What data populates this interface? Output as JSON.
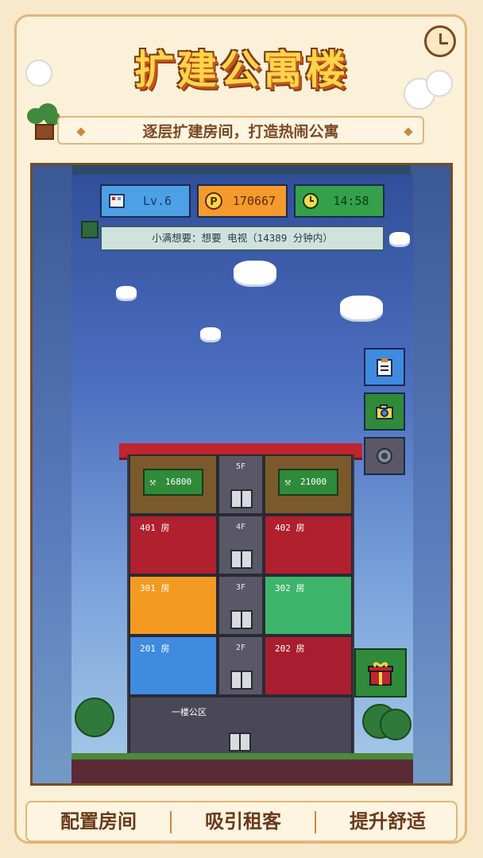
{
  "header": {
    "title": "扩建公寓楼",
    "subtitle": "逐层扩建房间，打造热闹公寓"
  },
  "hud": {
    "level": "Lv.6",
    "coins": "170667",
    "time": "14:58"
  },
  "wish_banner": "小满想要：想要 电视（14389 分钟内）",
  "building": {
    "top_floor_label": "5F",
    "build_costs": [
      "16800",
      "21000"
    ],
    "floors": [
      {
        "floor": "4F",
        "rooms": [
          "401 房",
          "402 房"
        ]
      },
      {
        "floor": "3F",
        "rooms": [
          "301 房",
          "302 房"
        ]
      },
      {
        "floor": "2F",
        "rooms": [
          "201 房",
          "202 房"
        ]
      }
    ],
    "lobby_label": "一楼公区"
  },
  "side_buttons": [
    "clipboard-icon",
    "camera-icon",
    "settings-icon"
  ],
  "bottom_tabs": [
    "配置房间",
    "吸引租客",
    "提升舒适"
  ],
  "colors": {
    "title_fill": "#ffd54a",
    "hud_level": "#4ea0e6",
    "hud_coins": "#f59a2c",
    "hud_time": "#34a04a",
    "roof": "#c0262e"
  }
}
